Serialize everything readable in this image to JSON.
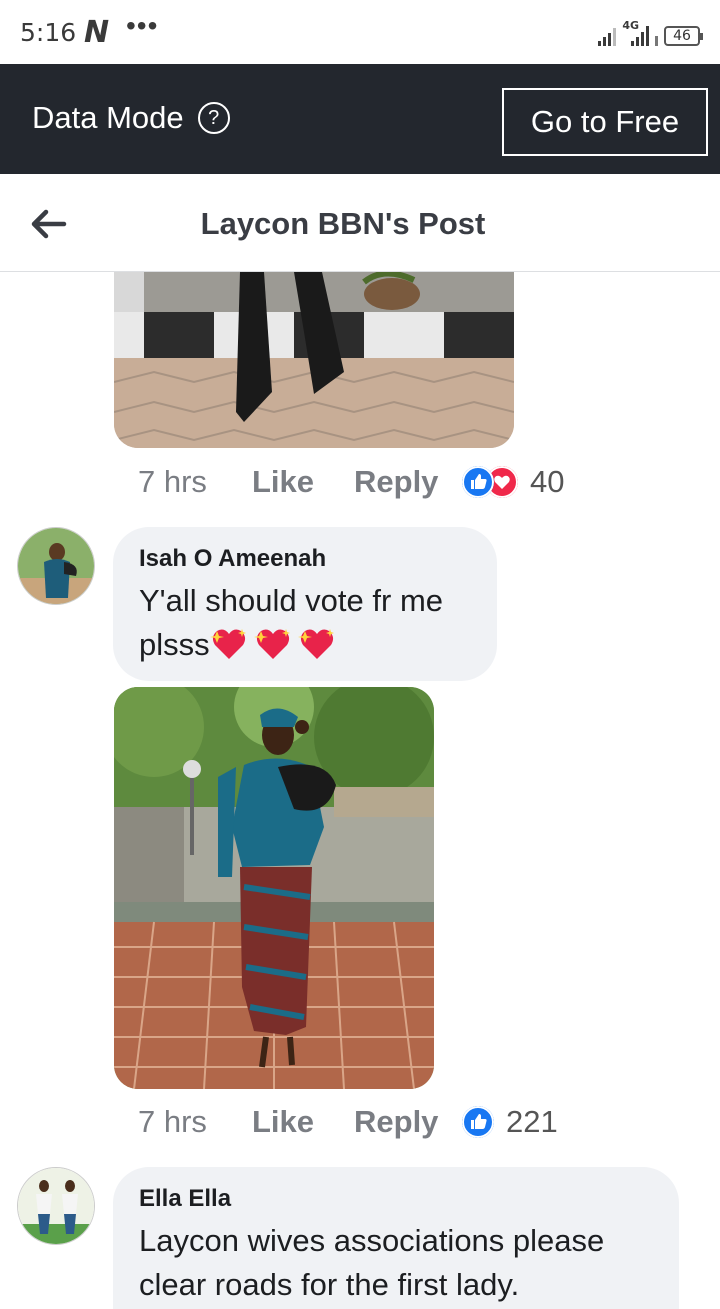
{
  "status_bar": {
    "time": "5:16",
    "carrier_icon": "N",
    "dots": "•••",
    "network": "4G",
    "battery": "46"
  },
  "data_bar": {
    "label": "Data Mode",
    "help_icon": "?",
    "button_label": "Go to Free"
  },
  "header": {
    "title": "Laycon BBN's Post"
  },
  "comments": [
    {
      "time": "7 hrs",
      "like_label": "Like",
      "reply_label": "Reply",
      "reaction_count": "40",
      "reactions": [
        "like-icon",
        "love-icon"
      ]
    },
    {
      "author": "Isah O Ameenah",
      "text_line1": "Y'all should vote fr me",
      "text_line2": "plsss",
      "emoji": [
        "sparkling-heart",
        "sparkling-heart",
        "sparkling-heart"
      ],
      "time": "7 hrs",
      "like_label": "Like",
      "reply_label": "Reply",
      "reaction_count": "221",
      "reactions": [
        "like-icon"
      ]
    },
    {
      "author": "Ella Ella",
      "text_line1": "Laycon wives associations please",
      "text_line2": "clear roads for the first lady."
    }
  ],
  "colors": {
    "data_bar_bg": "#23272e",
    "bubble_bg": "#f0f2f5",
    "like_blue": "#1877f2",
    "love_red": "#f0284a"
  }
}
